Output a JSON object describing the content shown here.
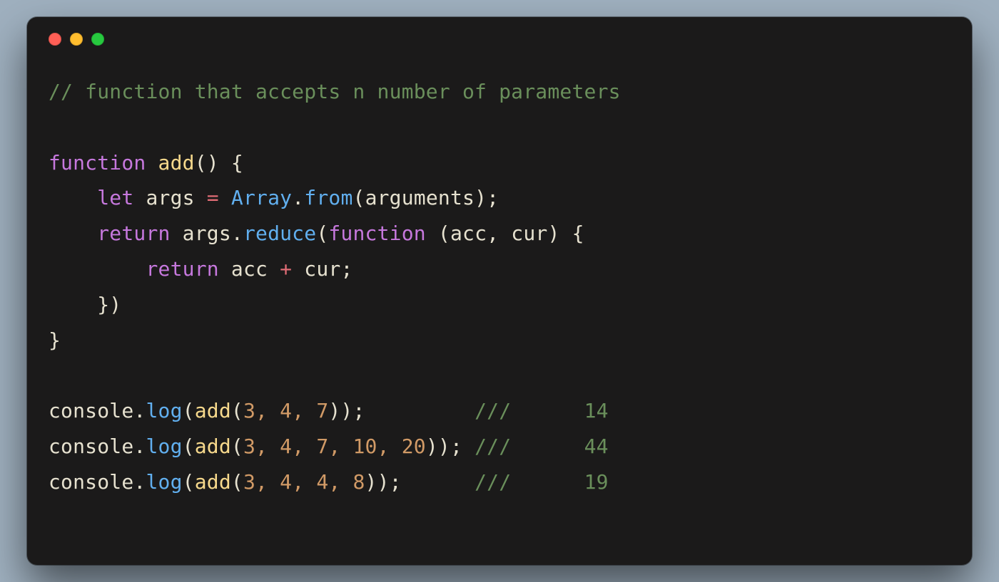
{
  "colors": {
    "background": "#9fb0bf",
    "window_bg": "#1b1a1a",
    "red": "#ff5f56",
    "yellow": "#ffbd2e",
    "green": "#27c93f",
    "comment": "#6a8f5b",
    "keyword": "#c678dd",
    "funcname": "#f7d98c",
    "builtin": "#61afef",
    "number": "#d19a66",
    "op": "#e06c75",
    "text": "#e6e1cf"
  },
  "code": {
    "comment_top": "// function that accepts n number of parameters",
    "kw_function1": "function",
    "fn_add": "add",
    "punct_l1": "() {",
    "indent1": "    ",
    "kw_let": "let",
    "sp": " ",
    "id_args": "args",
    "op_eq": " = ",
    "bi_Array": "Array",
    "punct_dot1": ".",
    "bi_from": "from",
    "punct_open1": "(",
    "id_arguments": "arguments",
    "punct_close1": ");",
    "kw_return1": "return",
    "punct_dot2": ".",
    "bi_reduce": "reduce",
    "punct_open2": "(",
    "kw_function2": "function",
    "punct_space_open": " (",
    "id_acc": "acc",
    "punct_comma": ", ",
    "id_cur": "cur",
    "punct_close_paren": ") {",
    "indent2": "        ",
    "kw_return2": "return",
    "op_plus": " + ",
    "punct_semi": ";",
    "punct_l6": "    })",
    "punct_l7": "}",
    "call_console": "console",
    "call_log": "log",
    "call_add": "add",
    "calls": [
      {
        "args": "3, 4, 7",
        "pad": "         ",
        "slash": "///      ",
        "result": "14"
      },
      {
        "args": "3, 4, 7, 10, 20",
        "pad": " ",
        "slash": "///      ",
        "result": "44"
      },
      {
        "args": "3, 4, 4, 8",
        "pad": "      ",
        "slash": "///      ",
        "result": "19"
      }
    ]
  }
}
